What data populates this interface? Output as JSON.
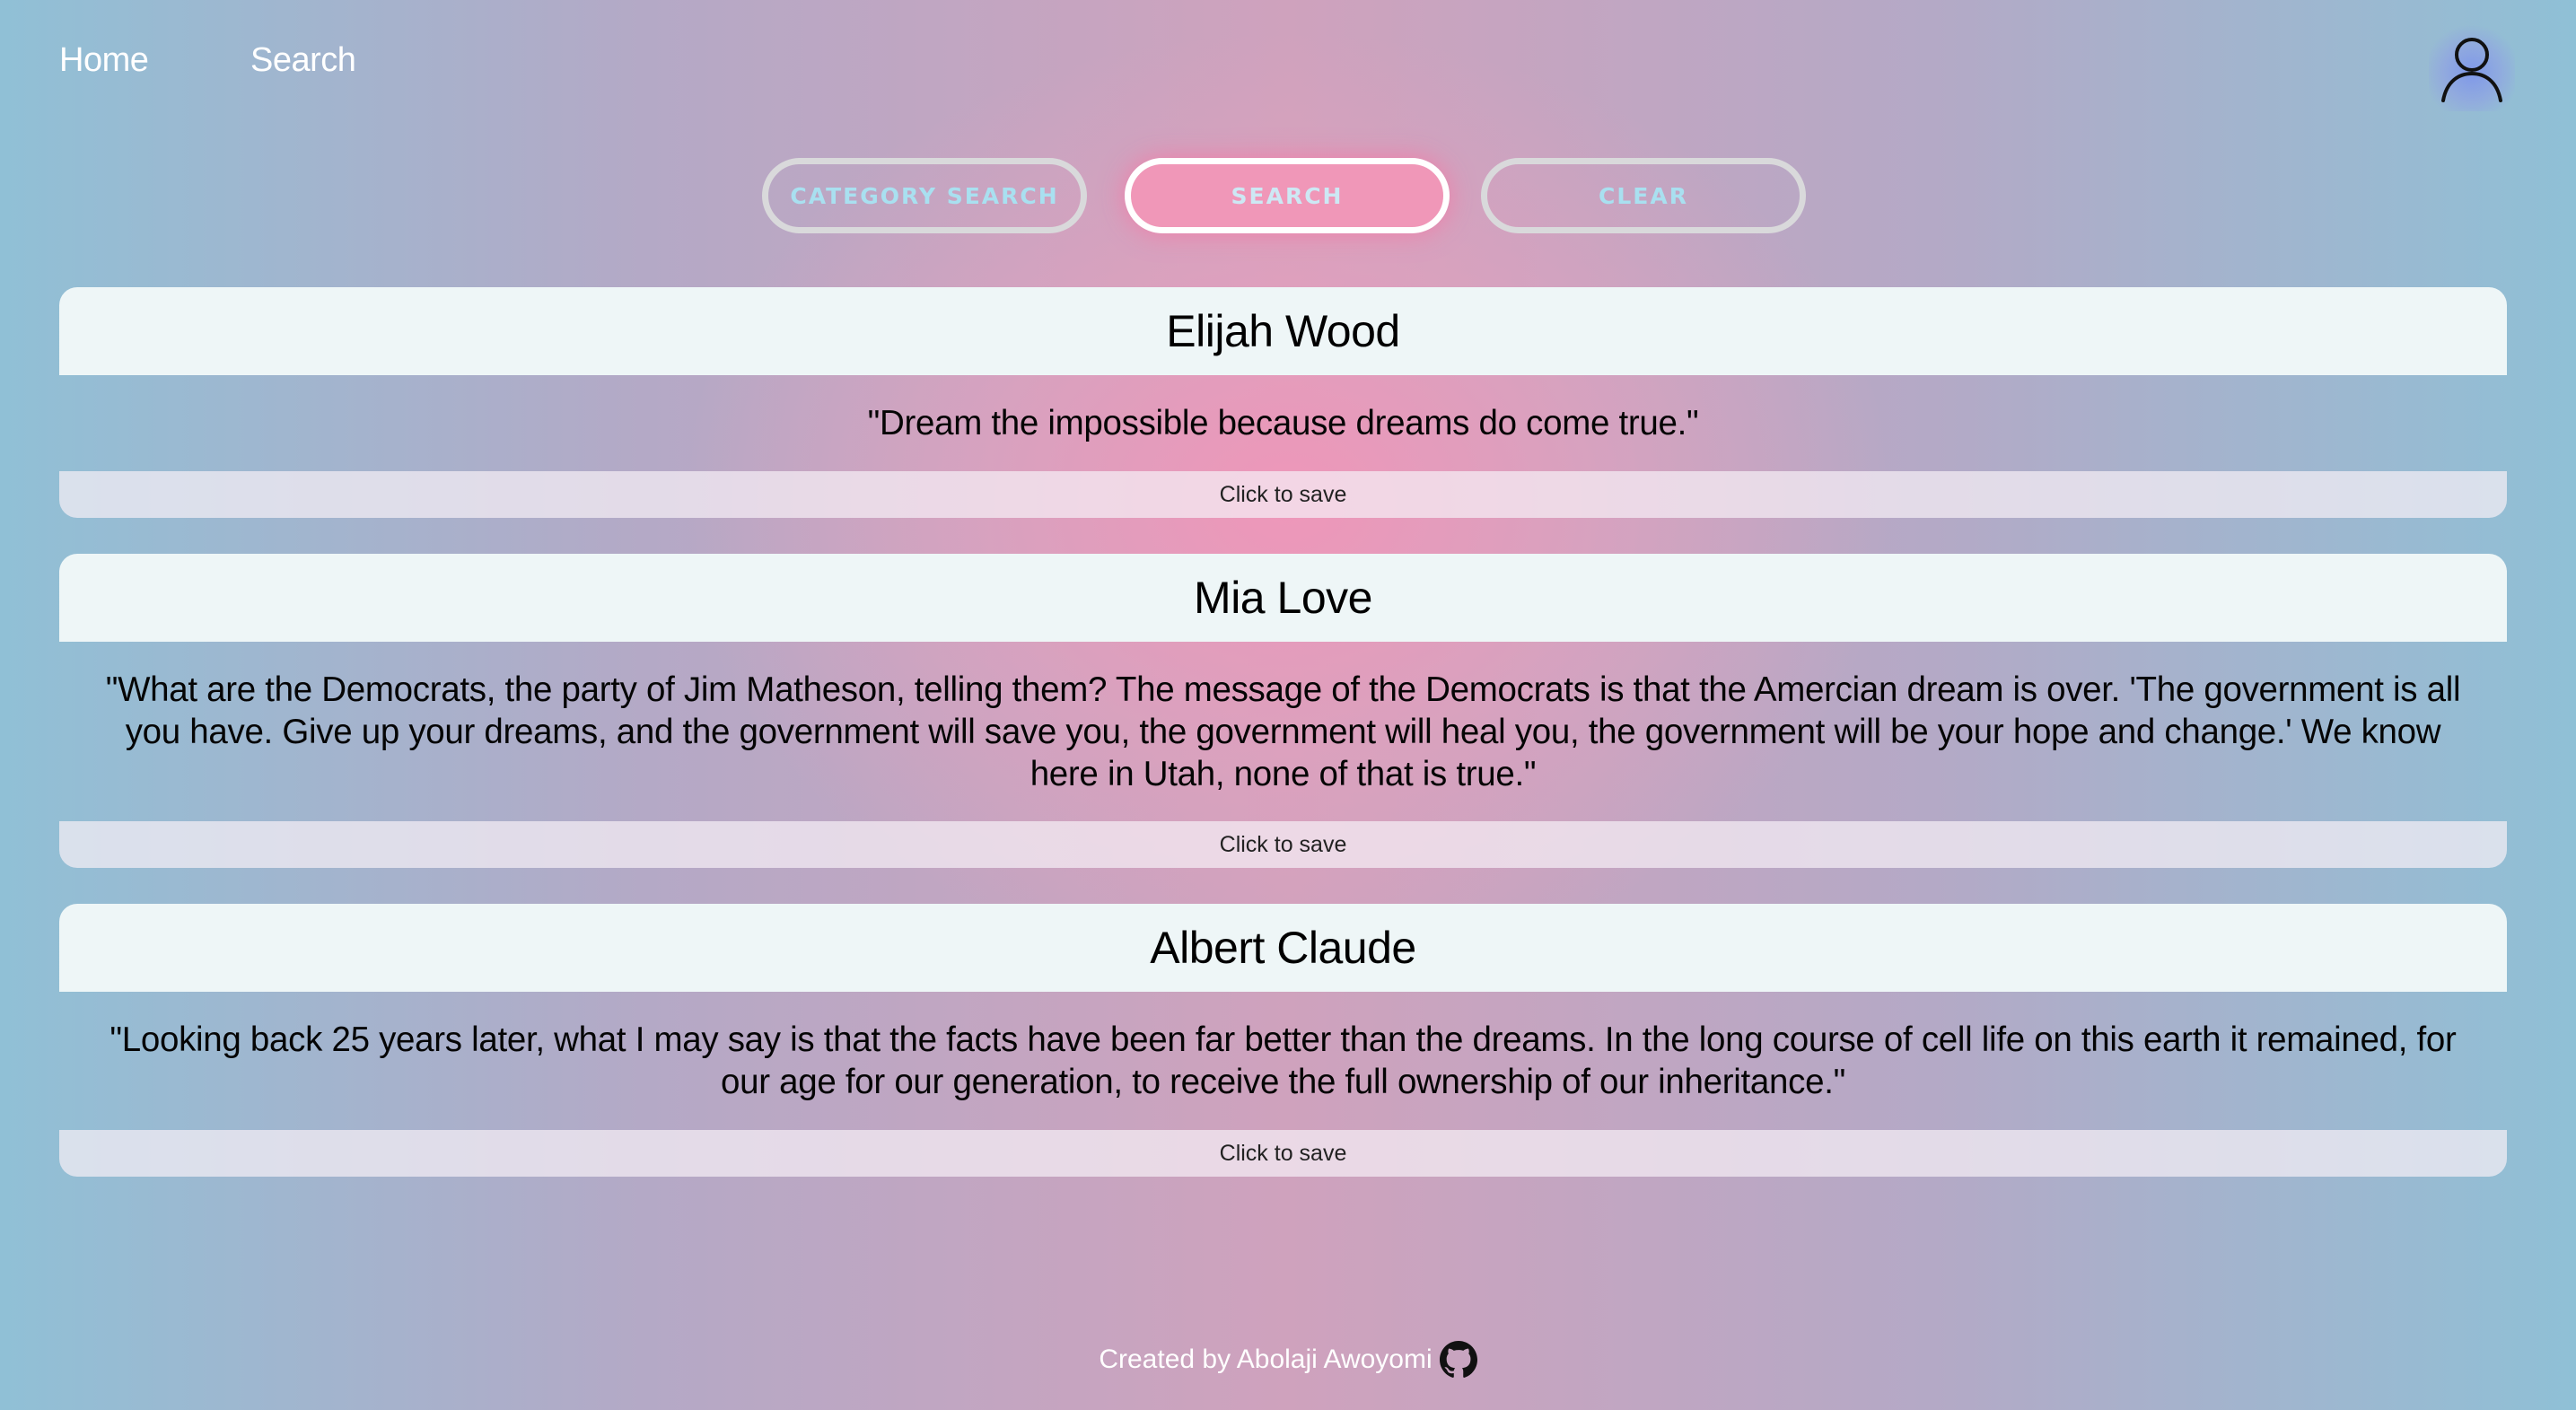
{
  "nav": {
    "home_label": "Home",
    "search_label": "Search"
  },
  "icons": {
    "user": "user-icon",
    "github": "github-icon"
  },
  "buttons": {
    "category_search": "CATEGORY SEARCH",
    "search": "SEARCH",
    "clear": "CLEAR"
  },
  "quotes": [
    {
      "author": "Elijah Wood",
      "text": "\"Dream the impossible because dreams do come true.\"",
      "save_label": "Click to save"
    },
    {
      "author": "Mia Love",
      "text": "\"What are the Democrats, the party of Jim Matheson, telling them? The message of the Democrats is that the Amercian dream is over. 'The government is all you have. Give up your dreams, and the government will save you, the government will heal you, the government will be your hope and change.' We know here in Utah, none of that is true.\"",
      "save_label": "Click to save"
    },
    {
      "author": "Albert Claude",
      "text": "\"Looking back 25 years later, what I may say is that the facts have been far better than the dreams. In the long course of cell life on this earth it remained, for our age for our generation, to receive the full ownership of our inheritance.\"",
      "save_label": "Click to save"
    }
  ],
  "footer": {
    "credit": "Created by Abolaji Awoyomi"
  },
  "colors": {
    "accent_pink": "#f097b8",
    "button_text": "#a9e0f0",
    "card_header": "#eef6f7"
  }
}
